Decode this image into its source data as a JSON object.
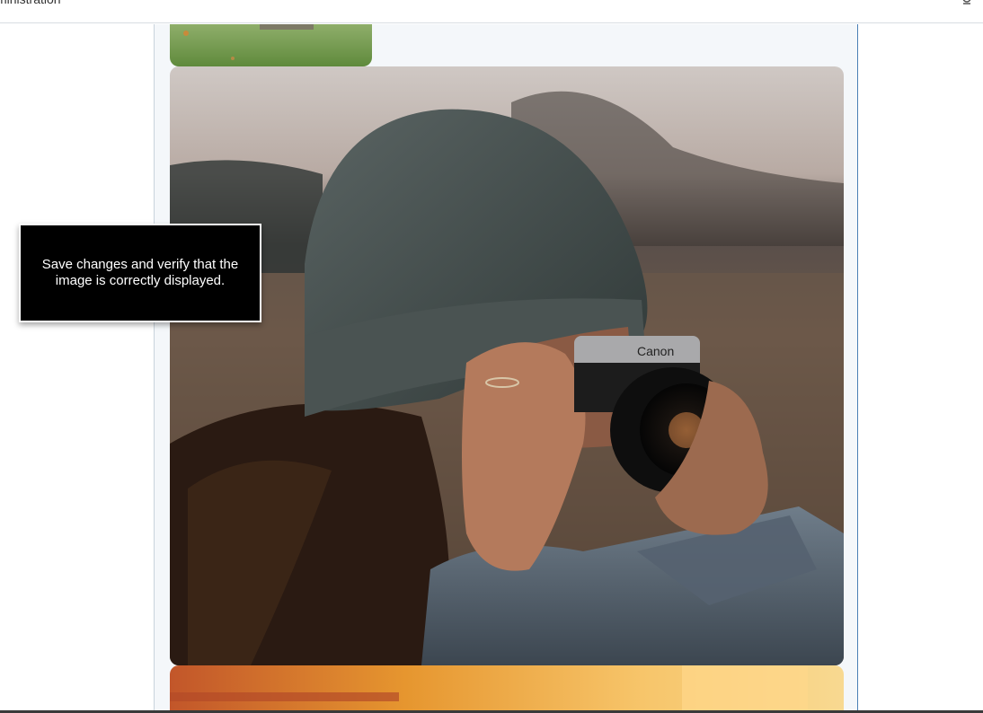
{
  "topbar": {
    "title": "ministration",
    "icon": "settings-icon"
  },
  "images": [
    {
      "name": "grass-thumbnail",
      "alt": "grass"
    },
    {
      "name": "photographer-with-camera",
      "alt": "person in beanie holding camera"
    },
    {
      "name": "warm-light-photo",
      "alt": "warm light"
    }
  ],
  "camera": {
    "brand": "Canon"
  },
  "tooltip": {
    "text": "Save changes and verify that the image is correctly displayed."
  },
  "colors": {
    "tooltip_bg": "#000000",
    "panel_bg": "#f4f7fa",
    "panel_border": "#4a7fb5"
  }
}
